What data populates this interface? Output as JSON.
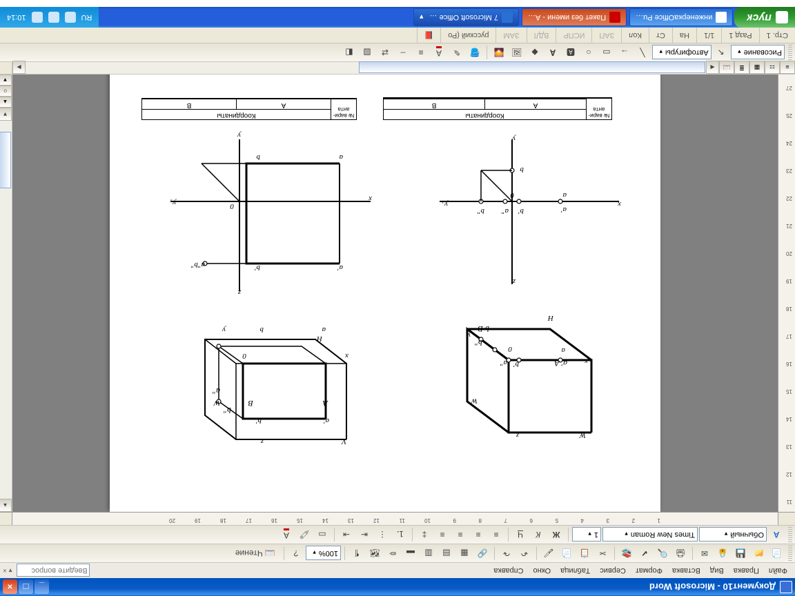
{
  "title": "Документ10 - Microsoft Word",
  "menu": [
    "Файл",
    "Правка",
    "Вид",
    "Вставка",
    "Формат",
    "Сервис",
    "Таблица",
    "Окно",
    "Справка"
  ],
  "help_placeholder": "Введите вопрос",
  "toolbar1": {
    "zoom": "100%",
    "read": "Чтение"
  },
  "toolbar2": {
    "style": "Обычный",
    "font": "Times New Roman",
    "size": "1"
  },
  "drawbar": {
    "draw_label": "Рисование",
    "autoshapes_label": "Автофигуры"
  },
  "status": {
    "page": "Стр. 1",
    "section": "Разд 1",
    "pages": "1/1",
    "at": "На",
    "ln": "Ст",
    "col": "Кол",
    "modes": [
      "ЗАП",
      "ИСПР",
      "ВДЛ",
      "ЗАМ"
    ],
    "lang": "русский (Ро"
  },
  "taskbar": {
    "start": "пуск",
    "items": [
      {
        "label": "инженеркаOffice Pu…"
      },
      {
        "label": "Пакет без имени - A…"
      },
      {
        "label": "7 Microsoft Office …"
      }
    ],
    "lang": "RU",
    "time": "10:14"
  },
  "ruler_h": [
    1,
    2,
    3,
    4,
    5,
    6,
    7,
    8,
    9,
    10,
    11,
    12,
    13,
    14,
    15,
    16,
    17,
    18,
    19,
    20
  ],
  "ruler_v": [
    11,
    12,
    13,
    14,
    15,
    16,
    17,
    18,
    19,
    20,
    21,
    22,
    23,
    24,
    25,
    27
  ],
  "doc": {
    "table_header": "Координаты",
    "col_a": "А",
    "col_b": "В",
    "row_label": "№ вари-анта",
    "labels": {
      "W": "W",
      "z": "z",
      "H": "H",
      "x": "x",
      "y": "y",
      "y1": "y₁",
      "V": "V",
      "O": "0",
      "a": "a",
      "b": "b",
      "ap": "a'",
      "bp": "b'",
      "app": "a\"",
      "bpp": "b\"",
      "A": "A",
      "B": "B",
      "apbp": "a\"b\""
    }
  }
}
